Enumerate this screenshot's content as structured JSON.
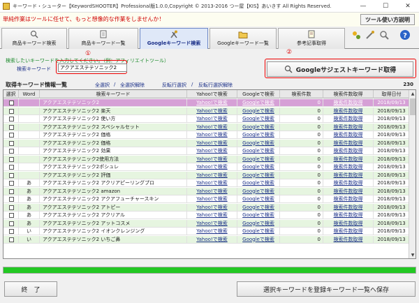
{
  "window": {
    "title": "キーワード・シューター【KeywordSHOOTER】Professional版1.0.0,Copyright © 2013-2016 つー屋【KIS】あいきす All Rights Reserved.",
    "minimize": "—",
    "maximize": "☐",
    "close": "✕"
  },
  "banner": {
    "message": "単純作業はツールに任せて、もっと想像的な作業をしませんか！",
    "help_button": "ツール使い方説明"
  },
  "tabs": [
    {
      "label": "商品キーワード検索",
      "icon": "magnifier-icon"
    },
    {
      "label": "商品キーワード一覧",
      "icon": "document-icon"
    },
    {
      "label": "Googleキーワード検索",
      "icon": "tools-icon"
    },
    {
      "label": "Googleキーワード一覧",
      "icon": "folder-icon"
    },
    {
      "label": "参考記事取得",
      "icon": "notes-icon"
    }
  ],
  "search": {
    "hint": "検索したいキーワードを入力してください。（例：アフィリエイトツール）",
    "label": "検索キーワード",
    "value": "アクアエステテソニック2",
    "marker1": "①",
    "marker2": "②",
    "suggest_button": "Googleサジェストキーワード取得"
  },
  "list": {
    "title": "取得キーワード情報一覧",
    "select_all": "全選択",
    "deselect_all": "全選択解除",
    "invert": "反転行選択",
    "invert_clear": "反転行選択解除",
    "count": "230"
  },
  "table": {
    "headers": [
      "選択",
      "Word",
      "検索キーワード",
      "Yahoo!で検索",
      "Googleで検索",
      "検索件数",
      "検索件数取得",
      "取得日付"
    ],
    "rows": [
      {
        "word": "",
        "keyword": "アクアエステテソニック2",
        "yahoo": "Yahoo!で検索",
        "google": "Googleで検索",
        "count": "0",
        "fetch": "検索件数取得",
        "date": "2018/09/13"
      },
      {
        "word": "",
        "keyword": "アクアエステテソニック2 楽天",
        "yahoo": "Yahoo!で検索",
        "google": "Googleで検索",
        "count": "0",
        "fetch": "検索件数取得",
        "date": "2018/09/13"
      },
      {
        "word": "",
        "keyword": "アクアエステテソニック2 使い方",
        "yahoo": "Yahoo!で検索",
        "google": "Googleで検索",
        "count": "0",
        "fetch": "検索件数取得",
        "date": "2018/09/13"
      },
      {
        "word": "",
        "keyword": "アクアエステテソニック2 スペシャルセット",
        "yahoo": "Yahoo!で検索",
        "google": "Googleで検索",
        "count": "0",
        "fetch": "検索件数取得",
        "date": "2018/09/13"
      },
      {
        "word": "",
        "keyword": "アクアエステテソニック2 価格",
        "yahoo": "Yahoo!で検索",
        "google": "Googleで検索",
        "count": "0",
        "fetch": "検索件数取得",
        "date": "2018/09/13"
      },
      {
        "word": "",
        "keyword": "アクアエステテソニック2 価格",
        "yahoo": "Yahoo!で検索",
        "google": "Googleで検索",
        "count": "0",
        "fetch": "検索件数取得",
        "date": "2018/09/13"
      },
      {
        "word": "",
        "keyword": "アクアエステテソニック2 効果",
        "yahoo": "Yahoo!で検索",
        "google": "Googleで検索",
        "count": "0",
        "fetch": "検索件数取得",
        "date": "2018/09/13"
      },
      {
        "word": "",
        "keyword": "アクアエステテソニック2使用方法",
        "yahoo": "Yahoo!で検索",
        "google": "Googleで検索",
        "count": "0",
        "fetch": "検索件数取得",
        "date": "2018/09/13"
      },
      {
        "word": "",
        "keyword": "アクアエステテソニック2ポシュレ",
        "yahoo": "Yahoo!で検索",
        "google": "Googleで検索",
        "count": "0",
        "fetch": "検索件数取得",
        "date": "2018/09/13"
      },
      {
        "word": "",
        "keyword": "アクアエステテソニック2 評価",
        "yahoo": "Yahoo!で検索",
        "google": "Googleで検索",
        "count": "0",
        "fetch": "検索件数取得",
        "date": "2018/09/13"
      },
      {
        "word": "あ",
        "keyword": "アクアエステテソニック2 アクリアピーリングプロ",
        "yahoo": "Yahoo!で検索",
        "google": "Googleで検索",
        "count": "0",
        "fetch": "検索件数取得",
        "date": "2018/09/13"
      },
      {
        "word": "あ",
        "keyword": "アクアエステテソニック2 amazon",
        "yahoo": "Yahoo!で検索",
        "google": "Googleで検索",
        "count": "0",
        "fetch": "検索件数取得",
        "date": "2018/09/13"
      },
      {
        "word": "あ",
        "keyword": "アクアエステテソニック2 アクアフューチャースキン",
        "yahoo": "Yahoo!で検索",
        "google": "Googleで検索",
        "count": "0",
        "fetch": "検索件数取得",
        "date": "2018/09/13"
      },
      {
        "word": "あ",
        "keyword": "アクアエステテソニック2 アトピー",
        "yahoo": "Yahoo!で検索",
        "google": "Googleで検索",
        "count": "0",
        "fetch": "検索件数取得",
        "date": "2018/09/13"
      },
      {
        "word": "あ",
        "keyword": "アクアエステテソニック2 アクリアル",
        "yahoo": "Yahoo!で検索",
        "google": "Googleで検索",
        "count": "0",
        "fetch": "検索件数取得",
        "date": "2018/09/13"
      },
      {
        "word": "あ",
        "keyword": "アクアエステテソニック2 アットコスメ",
        "yahoo": "Yahoo!で検索",
        "google": "Googleで検索",
        "count": "0",
        "fetch": "検索件数取得",
        "date": "2018/09/13"
      },
      {
        "word": "い",
        "keyword": "アクアエステテソニック2 イオンクレンジング",
        "yahoo": "Yahoo!で検索",
        "google": "Googleで検索",
        "count": "0",
        "fetch": "検索件数取得",
        "date": "2018/09/13"
      },
      {
        "word": "い",
        "keyword": "アクアエステテソニック2 いちご鼻",
        "yahoo": "Yahoo!で検索",
        "google": "Googleで検索",
        "count": "0",
        "fetch": "検索件数取得",
        "date": "2018/09/13"
      }
    ]
  },
  "progress": {
    "value": 1.0,
    "color": "#22c822"
  },
  "buttons": {
    "exit": "終　了",
    "save": "選択キーワードを登録キーワード一覧へ保存"
  },
  "colors": {
    "accent": "#1a2f88",
    "alert": "#e00000",
    "selected_row": "#d6a0d6",
    "alt_row": "#e6f5e0"
  }
}
